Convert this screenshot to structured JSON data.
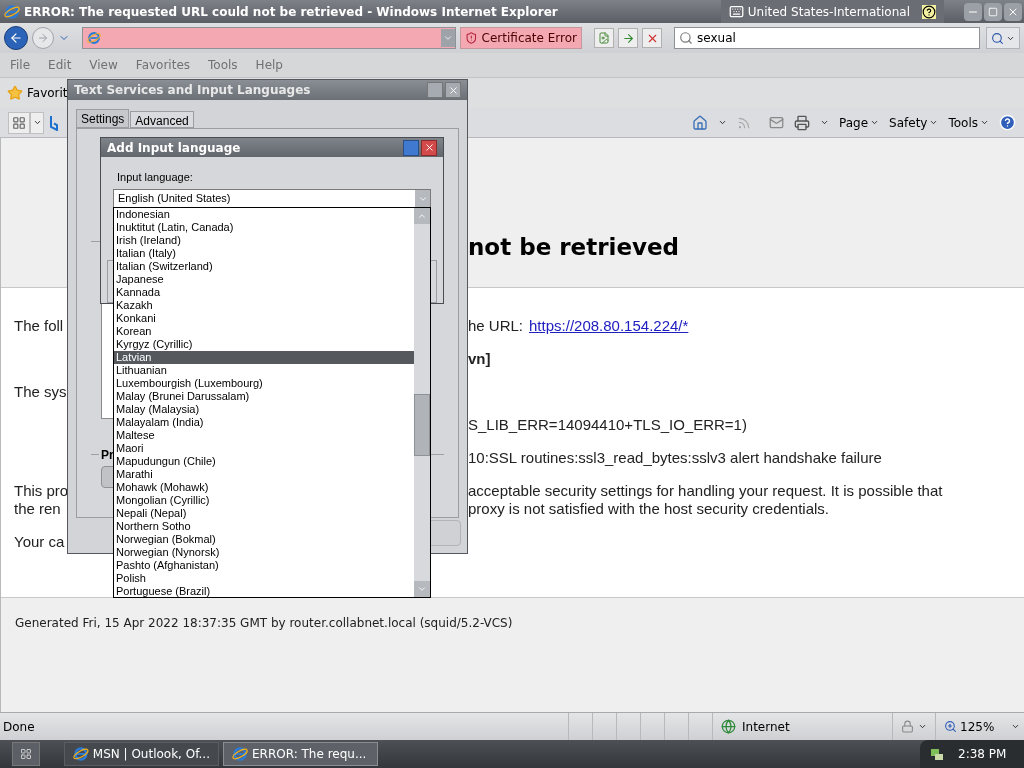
{
  "window": {
    "title": "ERROR: The requested URL could not be retrieved - Windows Internet Explorer",
    "language_bar": "United States-International"
  },
  "toolbar": {
    "certificate_label": "Certificate Error",
    "search_value": "sexual"
  },
  "menu_bar": [
    {
      "label": "File",
      "disabled": true
    },
    {
      "label": "Edit",
      "disabled": true
    },
    {
      "label": "View",
      "disabled": true
    },
    {
      "label": "Favorites",
      "disabled": true
    },
    {
      "label": "Tools",
      "disabled": true
    },
    {
      "label": "Help",
      "disabled": true
    }
  ],
  "favorites_bar": {
    "label": "Favorit"
  },
  "command_bar": [
    "Page",
    "Safety",
    "Tools"
  ],
  "page": {
    "heading": "not be retrieved",
    "paragraphs": [
      {
        "kind": "text",
        "rows": [
          {
            "left": "The foll",
            "right": "he URL:",
            "link": "https://208.80.154.224/*"
          }
        ]
      },
      {
        "kind": "bold",
        "rows": [
          {
            "right": "vn]"
          }
        ]
      },
      {
        "kind": "text",
        "rows": [
          {
            "left": "The sys"
          }
        ]
      },
      {
        "kind": "text",
        "rows": [
          {
            "right": "S_LIB_ERR=14094410+TLS_IO_ERR=1)"
          }
        ]
      },
      {
        "kind": "text",
        "rows": [
          {
            "right": "10:SSL routines:ssl3_read_bytes:sslv3 alert handshake failure"
          }
        ]
      },
      {
        "kind": "text",
        "rows": [
          {
            "left": "This pro",
            "right": "acceptable security settings for handling your request. It is possible that"
          },
          {
            "left": "the ren",
            "right": "proxy is not satisfied with the host security credentials."
          }
        ]
      },
      {
        "kind": "text",
        "rows": [
          {
            "left": "Your ca"
          }
        ]
      }
    ],
    "footer": "Generated Fri, 15 Apr 2022 18:37:35 GMT by router.collabnet.local (squid/5.2-VCS)"
  },
  "status_bar": {
    "text": "Done",
    "zone": "Internet",
    "zoom": "125%"
  },
  "taskbar": {
    "buttons": [
      {
        "label": "MSN | Outlook, Of...",
        "selected": false
      },
      {
        "label": "ERROR: The requ...",
        "selected": true
      }
    ],
    "clock": "2:38 PM"
  },
  "dialog": {
    "title": "Text Services and Input Languages",
    "tabs": [
      {
        "label": "Settings",
        "selected": true
      },
      {
        "label": "Advanced",
        "selected": false
      }
    ],
    "group_label": "Pr"
  },
  "add_dialog": {
    "title": "Add Input language",
    "field_label": "Input language:",
    "value": "English (United States)",
    "options": [
      {
        "label": "Indonesian",
        "selected": false
      },
      {
        "label": "Inuktitut (Latin, Canada)",
        "selected": false
      },
      {
        "label": "Irish (Ireland)",
        "selected": false
      },
      {
        "label": "Italian (Italy)",
        "selected": false
      },
      {
        "label": "Italian (Switzerland)",
        "selected": false
      },
      {
        "label": "Japanese",
        "selected": false
      },
      {
        "label": "Kannada",
        "selected": false
      },
      {
        "label": "Kazakh",
        "selected": false
      },
      {
        "label": "Konkani",
        "selected": false
      },
      {
        "label": "Korean",
        "selected": false
      },
      {
        "label": "Kyrgyz (Cyrillic)",
        "selected": false
      },
      {
        "label": "Latvian",
        "selected": true
      },
      {
        "label": "Lithuanian",
        "selected": false
      },
      {
        "label": "Luxembourgish (Luxembourg)",
        "selected": false
      },
      {
        "label": "Malay (Brunei Darussalam)",
        "selected": false
      },
      {
        "label": "Malay (Malaysia)",
        "selected": false
      },
      {
        "label": "Malayalam (India)",
        "selected": false
      },
      {
        "label": "Maltese",
        "selected": false
      },
      {
        "label": "Maori",
        "selected": false
      },
      {
        "label": "Mapudungun (Chile)",
        "selected": false
      },
      {
        "label": "Marathi",
        "selected": false
      },
      {
        "label": "Mohawk (Mohawk)",
        "selected": false
      },
      {
        "label": "Mongolian (Cyrillic)",
        "selected": false
      },
      {
        "label": "Nepali (Nepal)",
        "selected": false
      },
      {
        "label": "Northern Sotho",
        "selected": false
      },
      {
        "label": "Norwegian (Bokmal)",
        "selected": false
      },
      {
        "label": "Norwegian (Nynorsk)",
        "selected": false
      },
      {
        "label": "Pashto (Afghanistan)",
        "selected": false
      },
      {
        "label": "Polish",
        "selected": false
      },
      {
        "label": "Portuguese (Brazil)",
        "selected": false
      }
    ]
  }
}
